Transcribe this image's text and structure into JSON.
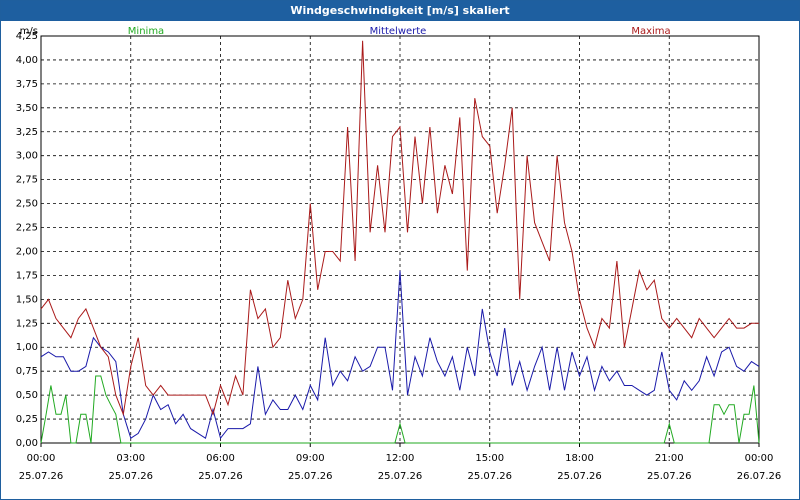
{
  "window": {
    "title": "Windgeschwindigkeit [m/s] skaliert"
  },
  "chart_data": {
    "type": "line",
    "title": "Windgeschwindigkeit [m/s] skaliert",
    "ylabel": "m/s",
    "ylim": [
      0,
      4.25
    ],
    "xlim": [
      0,
      24
    ],
    "grid": true,
    "legend": "top",
    "y_ticks": [
      "0,00",
      "0,25",
      "0,50",
      "0,75",
      "1,00",
      "1,25",
      "1,50",
      "1,75",
      "2,00",
      "2,25",
      "2,50",
      "2,75",
      "3,00",
      "3,25",
      "3,50",
      "3,75",
      "4,00",
      "4,25"
    ],
    "x_ticks": [
      {
        "time": "00:00",
        "date": "25.07.26"
      },
      {
        "time": "03:00",
        "date": "25.07.26"
      },
      {
        "time": "06:00",
        "date": "25.07.26"
      },
      {
        "time": "09:00",
        "date": "25.07.26"
      },
      {
        "time": "12:00",
        "date": "25.07.26"
      },
      {
        "time": "15:00",
        "date": "25.07.26"
      },
      {
        "time": "18:00",
        "date": "25.07.26"
      },
      {
        "time": "21:00",
        "date": "25.07.26"
      },
      {
        "time": "00:00",
        "date": "26.07.26"
      }
    ],
    "series": [
      {
        "name": "Minima",
        "color": "#22aa22",
        "x": [
          0,
          0.17,
          0.33,
          0.5,
          0.67,
          0.83,
          1.0,
          1.17,
          1.33,
          1.5,
          1.67,
          1.83,
          2.0,
          2.17,
          2.33,
          2.5,
          2.67,
          2.83,
          3.0,
          4,
          5,
          6,
          7,
          8,
          9,
          10,
          11,
          11.83,
          12.0,
          12.17,
          13,
          14,
          15,
          16,
          17,
          18,
          19,
          20,
          20.83,
          21.0,
          21.17,
          22,
          22.33,
          22.5,
          22.67,
          22.83,
          23.0,
          23.17,
          23.33,
          23.5,
          23.67,
          23.83,
          24.0
        ],
        "values": [
          0,
          0.3,
          0.6,
          0.3,
          0.3,
          0.5,
          0.0,
          0.0,
          0.3,
          0.3,
          0.0,
          0.7,
          0.7,
          0.5,
          0.4,
          0.3,
          0.0,
          0.0,
          0.0,
          0,
          0,
          0,
          0,
          0,
          0,
          0,
          0,
          0.0,
          0.2,
          0.0,
          0,
          0,
          0,
          0,
          0,
          0,
          0,
          0,
          0.0,
          0.2,
          0.0,
          0,
          0.0,
          0.4,
          0.4,
          0.3,
          0.4,
          0.4,
          0.0,
          0.3,
          0.3,
          0.6,
          0.0
        ]
      },
      {
        "name": "Mittelwerte",
        "color": "#1a1aaa",
        "x": [
          0,
          0.25,
          0.5,
          0.75,
          1.0,
          1.25,
          1.5,
          1.75,
          2.0,
          2.25,
          2.5,
          2.75,
          3.0,
          3.25,
          3.5,
          3.75,
          4.0,
          4.25,
          4.5,
          4.75,
          5.0,
          5.25,
          5.5,
          5.75,
          6.0,
          6.25,
          6.5,
          6.75,
          7.0,
          7.25,
          7.5,
          7.75,
          8.0,
          8.25,
          8.5,
          8.75,
          9.0,
          9.25,
          9.5,
          9.75,
          10.0,
          10.25,
          10.5,
          10.75,
          11.0,
          11.25,
          11.5,
          11.75,
          12.0,
          12.25,
          12.5,
          12.75,
          13.0,
          13.25,
          13.5,
          13.75,
          14.0,
          14.25,
          14.5,
          14.75,
          15.0,
          15.25,
          15.5,
          15.75,
          16.0,
          16.25,
          16.5,
          16.75,
          17.0,
          17.25,
          17.5,
          17.75,
          18.0,
          18.25,
          18.5,
          18.75,
          19.0,
          19.25,
          19.5,
          19.75,
          20.0,
          20.25,
          20.5,
          20.75,
          21.0,
          21.25,
          21.5,
          21.75,
          22.0,
          22.25,
          22.5,
          22.75,
          23.0,
          23.25,
          23.5,
          23.75,
          24.0
        ],
        "values": [
          0.9,
          0.95,
          0.9,
          0.9,
          0.75,
          0.75,
          0.8,
          1.1,
          1.0,
          0.95,
          0.85,
          0.3,
          0.05,
          0.1,
          0.25,
          0.5,
          0.35,
          0.4,
          0.2,
          0.3,
          0.15,
          0.1,
          0.05,
          0.35,
          0.05,
          0.15,
          0.15,
          0.15,
          0.2,
          0.8,
          0.3,
          0.45,
          0.35,
          0.35,
          0.5,
          0.35,
          0.6,
          0.45,
          1.1,
          0.6,
          0.75,
          0.65,
          0.9,
          0.75,
          0.8,
          1.0,
          1.0,
          0.55,
          1.8,
          0.5,
          0.9,
          0.7,
          1.1,
          0.85,
          0.7,
          0.9,
          0.55,
          1.0,
          0.7,
          1.4,
          0.95,
          0.7,
          1.2,
          0.6,
          0.85,
          0.55,
          0.8,
          1.0,
          0.55,
          1.0,
          0.55,
          0.95,
          0.7,
          0.9,
          0.55,
          0.8,
          0.65,
          0.75,
          0.6,
          0.6,
          0.55,
          0.5,
          0.55,
          0.95,
          0.55,
          0.45,
          0.65,
          0.55,
          0.65,
          0.9,
          0.7,
          0.95,
          1.0,
          0.8,
          0.75,
          0.85,
          0.8
        ]
      },
      {
        "name": "Maxima",
        "color": "#aa1a1a",
        "x": [
          0,
          0.25,
          0.5,
          0.75,
          1.0,
          1.25,
          1.5,
          1.75,
          2.0,
          2.25,
          2.5,
          2.75,
          3.0,
          3.25,
          3.5,
          3.75,
          4.0,
          4.25,
          4.5,
          4.75,
          5.0,
          5.25,
          5.5,
          5.75,
          6.0,
          6.25,
          6.5,
          6.75,
          7.0,
          7.25,
          7.5,
          7.75,
          8.0,
          8.25,
          8.5,
          8.75,
          9.0,
          9.25,
          9.5,
          9.75,
          10.0,
          10.25,
          10.5,
          10.75,
          11.0,
          11.25,
          11.5,
          11.75,
          12.0,
          12.25,
          12.5,
          12.75,
          13.0,
          13.25,
          13.5,
          13.75,
          14.0,
          14.25,
          14.5,
          14.75,
          15.0,
          15.25,
          15.5,
          15.75,
          16.0,
          16.25,
          16.5,
          16.75,
          17.0,
          17.25,
          17.5,
          17.75,
          18.0,
          18.25,
          18.5,
          18.75,
          19.0,
          19.25,
          19.5,
          19.75,
          20.0,
          20.25,
          20.5,
          20.75,
          21.0,
          21.25,
          21.5,
          21.75,
          22.0,
          22.25,
          22.5,
          22.75,
          23.0,
          23.25,
          23.5,
          23.75,
          24.0
        ],
        "values": [
          1.4,
          1.5,
          1.3,
          1.2,
          1.1,
          1.3,
          1.4,
          1.2,
          1.0,
          0.9,
          0.5,
          0.3,
          0.8,
          1.1,
          0.6,
          0.5,
          0.6,
          0.5,
          0.5,
          0.5,
          0.5,
          0.5,
          0.5,
          0.3,
          0.6,
          0.4,
          0.7,
          0.5,
          1.6,
          1.3,
          1.4,
          1.0,
          1.1,
          1.7,
          1.3,
          1.5,
          2.5,
          1.6,
          2.0,
          2.0,
          1.9,
          3.3,
          1.9,
          4.2,
          2.2,
          2.9,
          2.2,
          3.2,
          3.3,
          2.2,
          3.2,
          2.5,
          3.3,
          2.4,
          2.9,
          2.6,
          3.4,
          1.8,
          3.6,
          3.2,
          3.1,
          2.4,
          2.9,
          3.5,
          1.5,
          3.0,
          2.3,
          2.1,
          1.9,
          3.0,
          2.3,
          2.0,
          1.5,
          1.2,
          1.0,
          1.3,
          1.2,
          1.9,
          1.0,
          1.4,
          1.8,
          1.6,
          1.7,
          1.3,
          1.2,
          1.3,
          1.2,
          1.1,
          1.3,
          1.2,
          1.1,
          1.2,
          1.3,
          1.2,
          1.2,
          1.25,
          1.25
        ]
      }
    ]
  }
}
